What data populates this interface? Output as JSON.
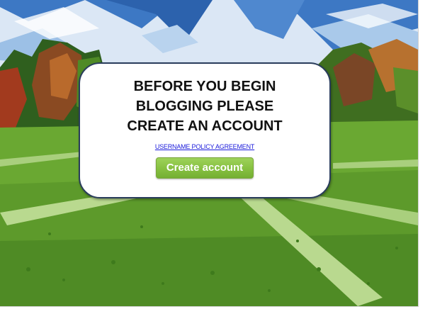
{
  "dialog": {
    "headline_lines": [
      "BEFORE YOU BEGIN",
      "BLOGGING PLEASE",
      "CREATE AN ACCOUNT"
    ],
    "policy_link_label": "USERNAME POLICY AGREEMENT",
    "create_button_label": "Create account"
  },
  "colors": {
    "button_green": "#86c040",
    "link_blue": "#1a1adb",
    "dialog_border": "#2a3d5c",
    "sky_blue": "#3d78c4",
    "grass_green": "#6aa832"
  }
}
